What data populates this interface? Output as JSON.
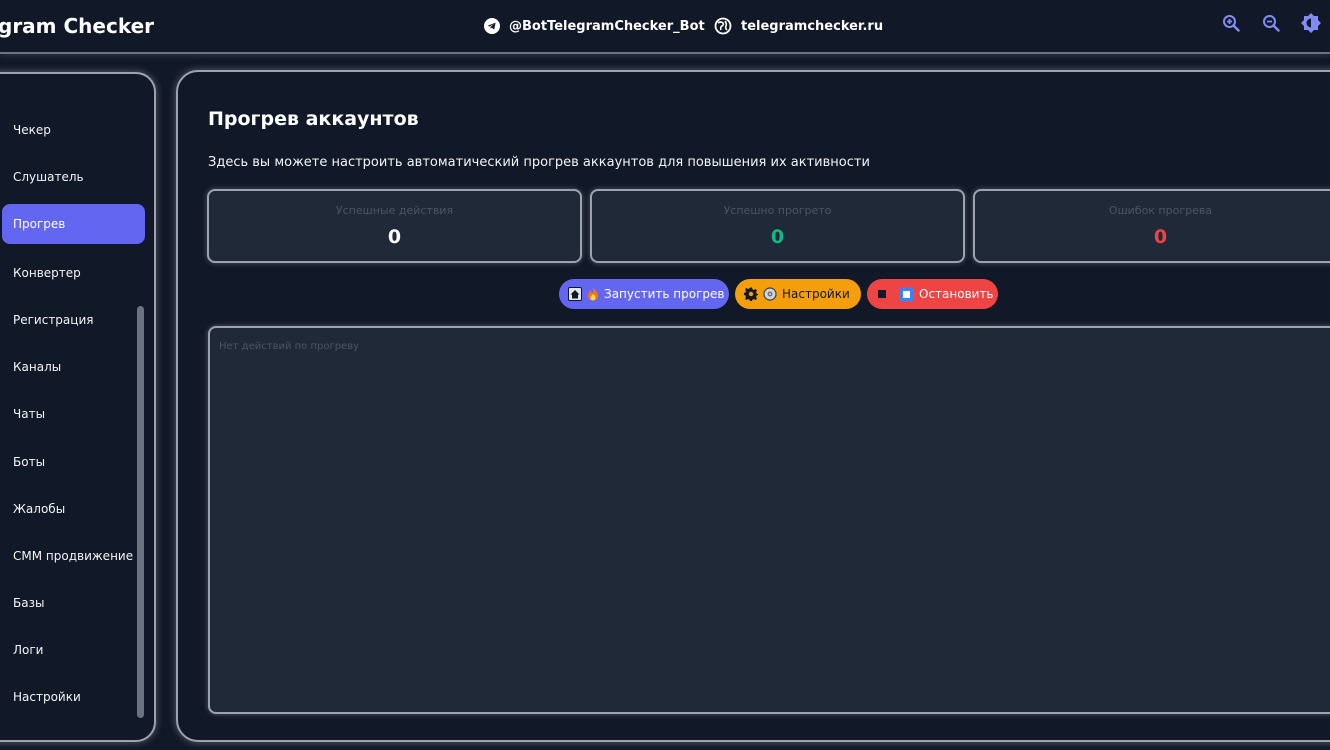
{
  "header": {
    "title": "gram Checker",
    "bot_link": "@BotTelegramChecker_Bot",
    "site_link": "telegramchecker.ru",
    "icons": [
      "telegram-icon",
      "globe-icon",
      "zoom-in-icon",
      "zoom-out-icon",
      "theme-toggle-icon"
    ]
  },
  "sidebar": {
    "items": [
      {
        "label": "Чекер",
        "active": false
      },
      {
        "label": "Слушатель",
        "active": false
      },
      {
        "label": "Прогрев",
        "active": true
      },
      {
        "label": "Конвертер",
        "active": false
      },
      {
        "label": "Регистрация",
        "active": false
      },
      {
        "label": "Каналы",
        "active": false
      },
      {
        "label": "Чаты",
        "active": false
      },
      {
        "label": "Боты",
        "active": false
      },
      {
        "label": "Жалобы",
        "active": false
      },
      {
        "label": "СММ продвижение",
        "active": false
      },
      {
        "label": "Базы",
        "active": false
      },
      {
        "label": "Логи",
        "active": false
      },
      {
        "label": "Настройки",
        "active": false
      }
    ]
  },
  "main": {
    "title": "Прогрев аккаунтов",
    "description": "Здесь вы можете настроить автоматический прогрев аккаунтов для повышения их активности",
    "stats": [
      {
        "label": "Успешные действия",
        "value": "0",
        "color": "#ffffff"
      },
      {
        "label": "Успешно прогрето",
        "value": "0",
        "color": "#10b981"
      },
      {
        "label": "Ошибок прогрева",
        "value": "0",
        "color": "#ef4444"
      }
    ],
    "buttons": {
      "start": "Запустить прогрев",
      "settings": "Настройки",
      "stop": "Остановить"
    },
    "log_empty": "Нет действий по прогреву"
  },
  "colors": {
    "accent": "#6366f1",
    "warning": "#f59e0b",
    "danger": "#ef4444",
    "success": "#10b981",
    "background": "#111827",
    "card": "#1f2937"
  }
}
